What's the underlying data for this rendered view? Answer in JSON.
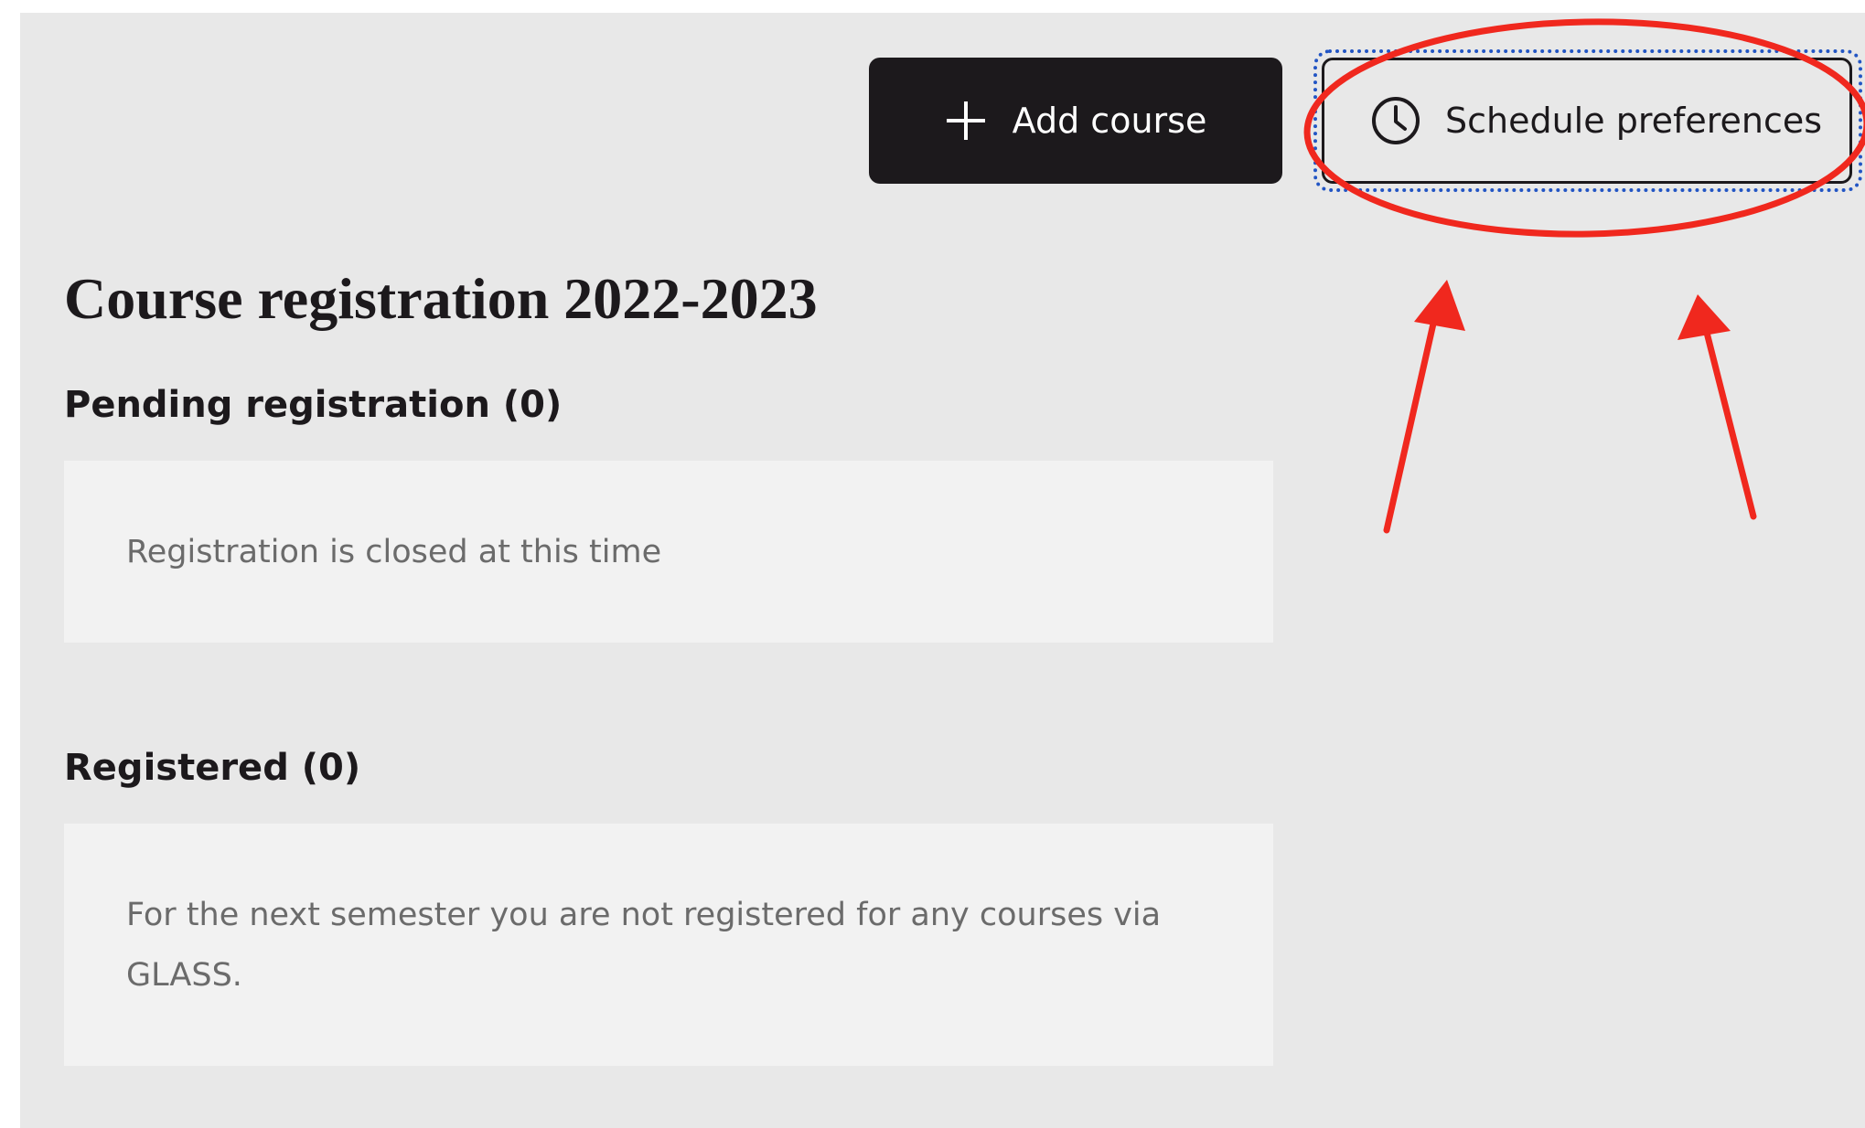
{
  "toolbar": {
    "add_course_label": "Add course",
    "schedule_preferences_label": "Schedule preferences"
  },
  "page": {
    "title": "Course registration 2022-2023"
  },
  "sections": {
    "pending": {
      "title": "Pending registration (0)",
      "message": "Registration is closed at this time"
    },
    "registered": {
      "title": "Registered (0)",
      "message": "For the next semester you are not registered for any courses via GLASS."
    }
  },
  "icons": {
    "add": "plus-icon",
    "schedule": "clock-icon"
  },
  "colors": {
    "background": "#e8e8e8",
    "box": "#f2f2f2",
    "primary": "#1c191c",
    "annotation": "#f0281e",
    "focus": "#2255c4"
  }
}
